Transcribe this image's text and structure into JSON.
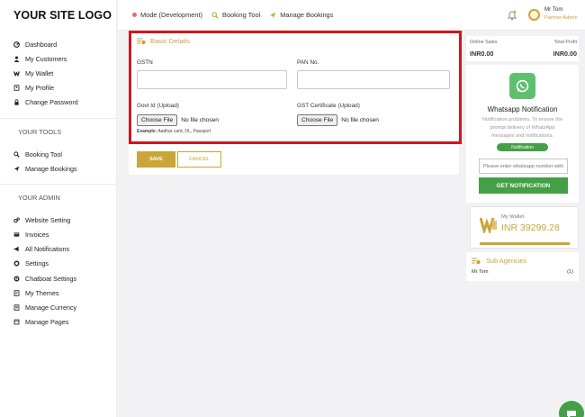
{
  "logo": "YOUR SITE LOGO",
  "sidebar": {
    "main_items": [
      {
        "label": "Dashboard",
        "icon": "dashboard-icon"
      },
      {
        "label": "My Customers",
        "icon": "user-icon"
      },
      {
        "label": "My Wallet",
        "icon": "wallet-icon"
      },
      {
        "label": "My Profile",
        "icon": "profile-icon"
      },
      {
        "label": "Change Password",
        "icon": "lock-icon"
      }
    ],
    "tools_title": "YOUR TOOLS",
    "tools_items": [
      {
        "label": "Booking Tool",
        "icon": "search-icon"
      },
      {
        "label": "Manage Bookings",
        "icon": "plane-icon"
      }
    ],
    "admin_title": "YOUR ADMIN",
    "admin_items": [
      {
        "label": "Website Setting",
        "icon": "gears-icon"
      },
      {
        "label": "Invoices",
        "icon": "invoice-icon"
      },
      {
        "label": "All Notifications",
        "icon": "megaphone-icon"
      },
      {
        "label": "Settings",
        "icon": "gear-icon"
      },
      {
        "label": "Chatboat Settings",
        "icon": "chat-gear-icon"
      },
      {
        "label": "My Themes",
        "icon": "theme-icon"
      },
      {
        "label": "Manage Currency",
        "icon": "currency-icon"
      },
      {
        "label": "Manage Pages",
        "icon": "pages-icon"
      }
    ]
  },
  "topbar": {
    "mode": "Mode (Development)",
    "booking_tool": "Booking Tool",
    "manage_bookings": "Manage Bookings",
    "user_name": "Mr Tom",
    "user_role": "Partner Admin"
  },
  "form": {
    "section_title": "Basic Details",
    "gstn_label": "GSTN",
    "gstn_value": "",
    "pan_label": "PAN No.",
    "pan_value": "",
    "govt_id_label": "Govt Id (Upload)",
    "gst_cert_label": "GST Certificate (Upload)",
    "choose_file": "Choose File",
    "no_file": "No file chosen",
    "hint_bold": "Example:",
    "hint_text": " Aadhar card, DL, Passport",
    "save": "SAVE",
    "cancel": "CANCEL"
  },
  "stats": {
    "online_sales_label": "Online Sales",
    "online_sales_value": "INR0.00",
    "total_profit_label": "Total Profit",
    "total_profit_value": "INR0.00"
  },
  "whatsapp": {
    "title": "Whatsapp Notification",
    "description": "Notification problems. To ensure the prompt delivery of WhatsApp messages and notifications.",
    "badge": "Notification",
    "input_placeholder": "Please enter whatsapp number with",
    "button": "GET NOTIFICATION"
  },
  "wallet": {
    "label": "My Wallet",
    "amount": "INR 39299.28"
  },
  "sub_agencies": {
    "title": "Sub Agencies",
    "rows": [
      {
        "name": "Mr Tom",
        "count": "(1)"
      }
    ]
  },
  "colors": {
    "accent": "#c9a53a",
    "highlight_border": "#d0161b",
    "green": "#43a047"
  }
}
